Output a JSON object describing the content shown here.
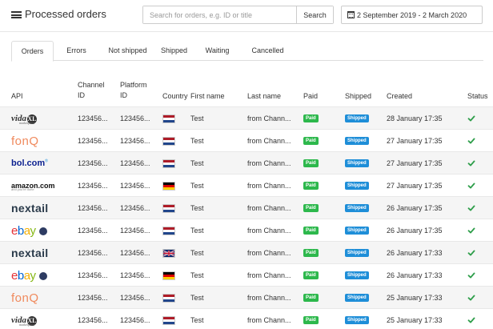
{
  "header": {
    "title": "Processed orders",
    "search_placeholder": "Search for orders, e.g. ID or title",
    "search_button": "Search",
    "date_range": "2 September 2019 - 2 March 2020"
  },
  "tabs": [
    {
      "label": "Orders",
      "active": true
    },
    {
      "label": "Errors",
      "active": false
    },
    {
      "label": "Not shipped",
      "active": false
    },
    {
      "label": "Shipped",
      "active": false
    },
    {
      "label": "Waiting",
      "active": false
    },
    {
      "label": "Cancelled",
      "active": false
    }
  ],
  "columns": {
    "api": "API",
    "channel_id": "Channel ID",
    "channel_id_l1": "Channel",
    "channel_id_l2": "ID",
    "platform_id_l1": "Platform",
    "platform_id_l2": "ID",
    "country": "Country",
    "first_name": "First name",
    "last_name": "Last name",
    "paid": "Paid",
    "shipped": "Shipped",
    "created": "Created",
    "status": "Status"
  },
  "logo_text": {
    "vidaxl_main": "vida",
    "vidaxl_xl": "XL",
    "vidaxl_sub": "marketplace",
    "fonq": "fonQ",
    "bol_main": "bol.com",
    "bol_sup": "®",
    "amazon_main": "amazon.com",
    "amazon_sub": "and you're done",
    "nextail": "nextail",
    "ebay_e": "e",
    "ebay_b": "b",
    "ebay_a": "a",
    "ebay_y": "y"
  },
  "rows": [
    {
      "api": "vidaxl",
      "channel_id": "123456...",
      "platform_id": "123456...",
      "country": "NL",
      "first_name": "Test",
      "last_name": "from Chann...",
      "paid": "Paid",
      "shipped": "Shipped",
      "created": "28 January 17:35",
      "status": "ok"
    },
    {
      "api": "fonq",
      "channel_id": "123456...",
      "platform_id": "123456...",
      "country": "NL",
      "first_name": "Test",
      "last_name": "from Chann...",
      "paid": "Paid",
      "shipped": "Shipped",
      "created": "27 January 17:35",
      "status": "ok"
    },
    {
      "api": "bol",
      "channel_id": "123456...",
      "platform_id": "123456...",
      "country": "NL",
      "first_name": "Test",
      "last_name": "from Chann...",
      "paid": "Paid",
      "shipped": "Shipped",
      "created": "27 January 17:35",
      "status": "ok"
    },
    {
      "api": "amazon",
      "channel_id": "123456...",
      "platform_id": "123456...",
      "country": "DE",
      "first_name": "Test",
      "last_name": "from Chann...",
      "paid": "Paid",
      "shipped": "Shipped",
      "created": "27 January 17:35",
      "status": "ok"
    },
    {
      "api": "nextail",
      "channel_id": "123456...",
      "platform_id": "123456...",
      "country": "NL",
      "first_name": "Test",
      "last_name": "from Chann...",
      "paid": "Paid",
      "shipped": "Shipped",
      "created": "26 January 17:35",
      "status": "ok"
    },
    {
      "api": "ebay",
      "channel_id": "123456...",
      "platform_id": "123456...",
      "country": "NL",
      "first_name": "Test",
      "last_name": "from Chann...",
      "paid": "Paid",
      "shipped": "Shipped",
      "created": "26 January 17:35",
      "status": "ok"
    },
    {
      "api": "nextail",
      "channel_id": "123456...",
      "platform_id": "123456...",
      "country": "GB",
      "first_name": "Test",
      "last_name": "from Chann...",
      "paid": "Paid",
      "shipped": "Shipped",
      "created": "26 January 17:33",
      "status": "ok"
    },
    {
      "api": "ebay",
      "channel_id": "123456...",
      "platform_id": "123456...",
      "country": "DE",
      "first_name": "Test",
      "last_name": "from Chann...",
      "paid": "Paid",
      "shipped": "Shipped",
      "created": "26 January 17:33",
      "status": "ok"
    },
    {
      "api": "fonq",
      "channel_id": "123456...",
      "platform_id": "123456...",
      "country": "NL",
      "first_name": "Test",
      "last_name": "from Chann...",
      "paid": "Paid",
      "shipped": "Shipped",
      "created": "25 January 17:33",
      "status": "ok"
    },
    {
      "api": "vidaxl",
      "channel_id": "123456...",
      "platform_id": "123456...",
      "country": "NL",
      "first_name": "Test",
      "last_name": "from Chann...",
      "paid": "Paid",
      "shipped": "Shipped",
      "created": "25 January 17:33",
      "status": "ok"
    }
  ],
  "colors": {
    "paid_badge": "#2db84c",
    "shipped_badge": "#1e8ed8",
    "check": "#2e9e4a",
    "row_stripe": "#f5f5f5"
  }
}
